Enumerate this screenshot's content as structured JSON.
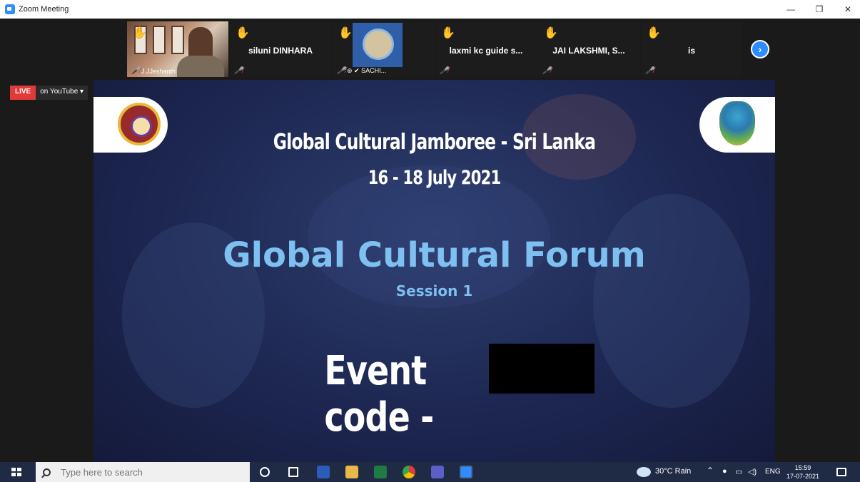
{
  "window": {
    "title": "Zoom Meeting",
    "controls": [
      "minimize",
      "restore",
      "close"
    ]
  },
  "participants": [
    {
      "name": "J.JJeshanth",
      "hand_raised": true,
      "muted": true,
      "has_video": true
    },
    {
      "name": "siluni DINHARA",
      "hand_raised": true,
      "muted": true,
      "has_video": false
    },
    {
      "name": "SACHI...",
      "hand_raised": true,
      "muted": true,
      "has_video": false
    },
    {
      "name": "laxmi kc guide s...",
      "hand_raised": true,
      "muted": true,
      "has_video": false
    },
    {
      "name": "JAI LAKSHMI, S...",
      "hand_raised": true,
      "muted": true,
      "has_video": false
    },
    {
      "name": "is",
      "hand_raised": true,
      "muted": true,
      "has_video": false
    }
  ],
  "live": {
    "badge": "LIVE",
    "platform": "on YouTube ▾"
  },
  "slide": {
    "headline": "Global Cultural Jamboree - Sri Lanka",
    "dates": "16 - 18 July 2021",
    "title": "Global Cultural Forum",
    "session": "Session 1",
    "event_code_label": "Event code -"
  },
  "taskbar": {
    "search_placeholder": "Type here to search",
    "weather": "30°C  Rain",
    "language": "ENG",
    "time": "15:59",
    "date": "17-07-2021"
  },
  "colors": {
    "zoom_blue": "#2d8cff",
    "live_red": "#e03a3a",
    "hand_yellow": "#f5b800",
    "slide_accent": "#7ec0f0",
    "taskbar_bg": "#1f2a44"
  }
}
